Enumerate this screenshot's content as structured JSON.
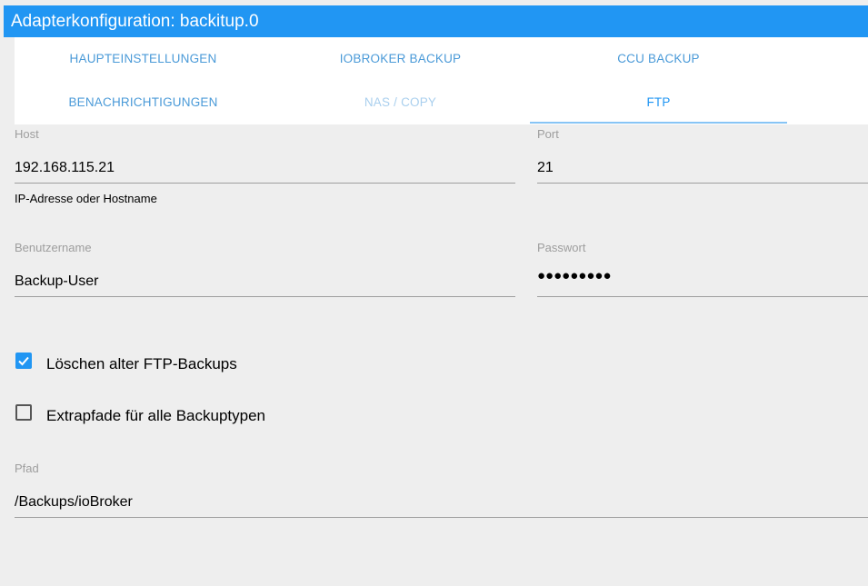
{
  "header": {
    "title": "Adapterkonfiguration: backitup.0"
  },
  "tabs": [
    {
      "label": "HAUPTEINSTELLUNGEN",
      "state": "normal"
    },
    {
      "label": "IOBROKER BACKUP",
      "state": "normal"
    },
    {
      "label": "CCU BACKUP",
      "state": "normal"
    },
    {
      "label": "BENACHRICHTIGUNGEN",
      "state": "normal"
    },
    {
      "label": "NAS / COPY",
      "state": "disabled"
    },
    {
      "label": "FTP",
      "state": "active"
    }
  ],
  "form": {
    "host": {
      "label": "Host",
      "value": "192.168.115.21",
      "helper": "IP-Adresse oder Hostname"
    },
    "port": {
      "label": "Port",
      "value": "21"
    },
    "username": {
      "label": "Benutzername",
      "value": "Backup-User"
    },
    "password": {
      "label": "Passwort",
      "masked": "●●●●●●●●●"
    },
    "delete_old": {
      "label": "Löschen alter FTP-Backups",
      "checked": true
    },
    "extra_paths": {
      "label": "Extrapfade für alle Backuptypen",
      "checked": false
    },
    "path": {
      "label": "Pfad",
      "value": "/Backups/ioBroker"
    }
  },
  "colors": {
    "primary": "#2196f3",
    "background": "#eeeeee",
    "tab_text": "#4a9ad8"
  }
}
